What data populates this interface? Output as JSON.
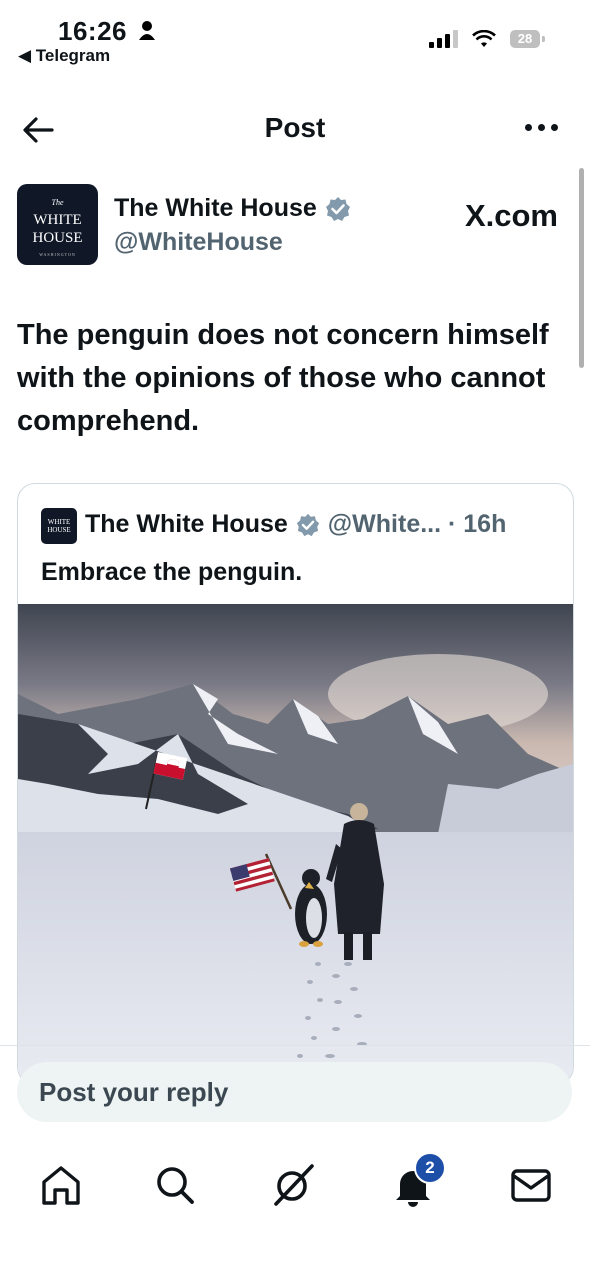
{
  "status_bar": {
    "time": "16:26",
    "back_app": "Telegram",
    "battery": "28"
  },
  "nav": {
    "title": "Post"
  },
  "post": {
    "author_name": "The White House",
    "author_handle": "@WhiteHouse",
    "source_label": "X.com",
    "avatar_text": {
      "top": "The",
      "line1": "WHITE",
      "line2": "HOUSE",
      "line3": "WASHINGTON"
    },
    "text": "The penguin does not concern himself with the opinions of those who cannot comprehend."
  },
  "quote": {
    "author_name": "The White House",
    "handle_time": "@White... · 16h",
    "text": "Embrace the penguin."
  },
  "reply_box": {
    "placeholder": "Post your reply"
  },
  "tabs": {
    "notifications_badge": "2"
  },
  "colors": {
    "verified": "#829aab",
    "badge": "#1d4ea8"
  }
}
